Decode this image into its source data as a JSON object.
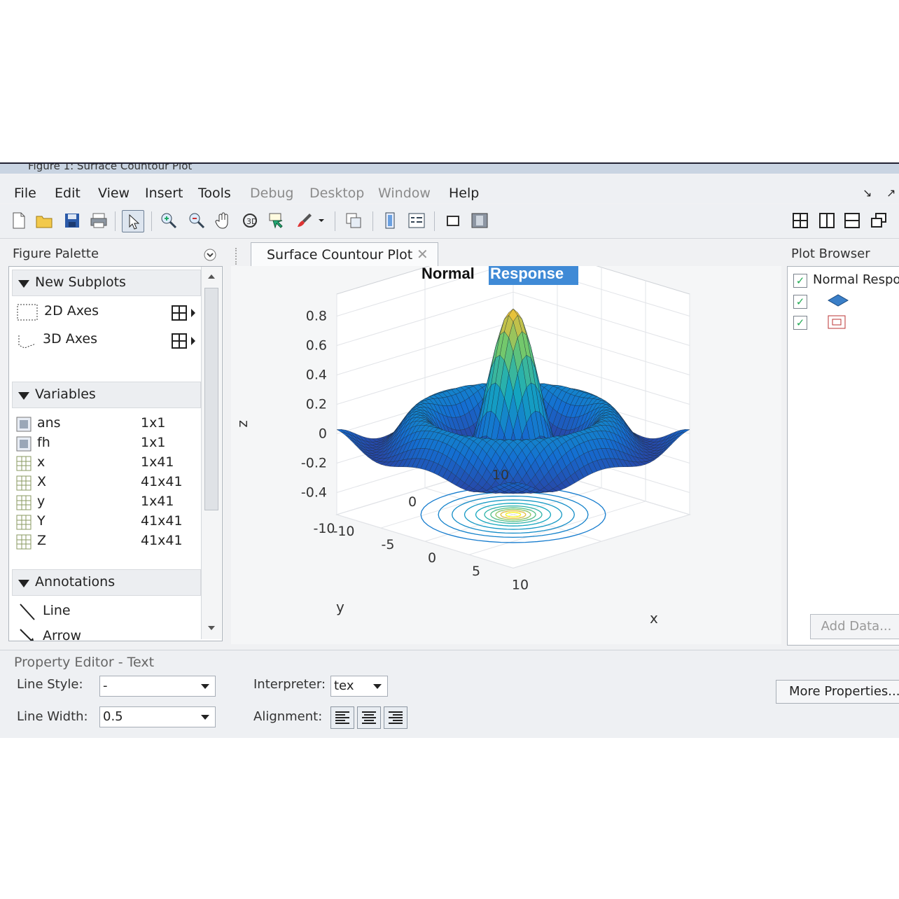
{
  "window": {
    "title": "Figure 1: Surface Countour Plot"
  },
  "menu": [
    {
      "label": "File",
      "enabled": true
    },
    {
      "label": "Edit",
      "enabled": true
    },
    {
      "label": "View",
      "enabled": true
    },
    {
      "label": "Insert",
      "enabled": true
    },
    {
      "label": "Tools",
      "enabled": true
    },
    {
      "label": "Debug",
      "enabled": false
    },
    {
      "label": "Desktop",
      "enabled": false
    },
    {
      "label": "Window",
      "enabled": false
    },
    {
      "label": "Help",
      "enabled": true
    }
  ],
  "menu_controls": {
    "dock": "↘",
    "undock": "↗"
  },
  "toolbar_icons": [
    "new-figure-icon",
    "open-file-icon",
    "save-icon",
    "print-icon",
    "edit-plot-arrow-icon",
    "zoom-in-icon",
    "zoom-out-icon",
    "pan-hand-icon",
    "rotate-3d-icon",
    "data-cursor-icon",
    "brush-icon",
    "brush-dropdown-icon",
    "link-plot-icon",
    "colorbar-icon",
    "legend-icon",
    "hide-plot-tools-icon",
    "show-plot-tools-icon",
    "tile-icon",
    "left-right-icon",
    "top-bottom-icon",
    "float-icon"
  ],
  "figure_palette": {
    "title": "Figure Palette",
    "new_subplots": {
      "label": "New Subplots",
      "items": [
        {
          "label": "2D Axes"
        },
        {
          "label": "3D Axes"
        }
      ]
    },
    "variables": {
      "label": "Variables",
      "items": [
        {
          "name": "ans",
          "size": "1x1"
        },
        {
          "name": "fh",
          "size": "1x1"
        },
        {
          "name": "x",
          "size": "1x41"
        },
        {
          "name": "X",
          "size": "41x41"
        },
        {
          "name": "y",
          "size": "1x41"
        },
        {
          "name": "Y",
          "size": "41x41"
        },
        {
          "name": "Z",
          "size": "41x41"
        }
      ]
    },
    "annotations": {
      "label": "Annotations",
      "items": [
        {
          "label": "Line"
        },
        {
          "label": "Arrow"
        }
      ]
    }
  },
  "tab": {
    "label": "Surface Countour Plot",
    "close": "✕"
  },
  "plot_browser": {
    "title": "Plot Browser",
    "item": "Normal Response",
    "add_data": "Add Data..."
  },
  "property_editor": {
    "title": "Property Editor - Text",
    "line_style": {
      "label": "Line Style:",
      "value": "-"
    },
    "line_width": {
      "label": "Line Width:",
      "value": "0.5"
    },
    "interpreter": {
      "label": "Interpreter:",
      "value": "tex"
    },
    "alignment": {
      "label": "Alignment:"
    },
    "more_properties": "More Properties..."
  },
  "chart_data": {
    "type": "surface",
    "title_parts": [
      "Normal",
      "Response"
    ],
    "title_selected_part": "Response",
    "xlabel": "x",
    "ylabel": "y",
    "zlabel": "z",
    "xticks": [
      "-10",
      "-5",
      "0",
      "5",
      "10"
    ],
    "yticks": [
      "-10",
      "0",
      "10"
    ],
    "zticks": [
      "-0.4",
      "-0.2",
      "0",
      "0.2",
      "0.4",
      "0.6",
      "0.8"
    ],
    "xlim": [
      -10,
      10
    ],
    "ylim": [
      -10,
      10
    ],
    "zlim": [
      -0.4,
      0.8
    ],
    "function": "sinc-like radial",
    "grid": true,
    "contour_below": true,
    "colormap": "parula"
  }
}
